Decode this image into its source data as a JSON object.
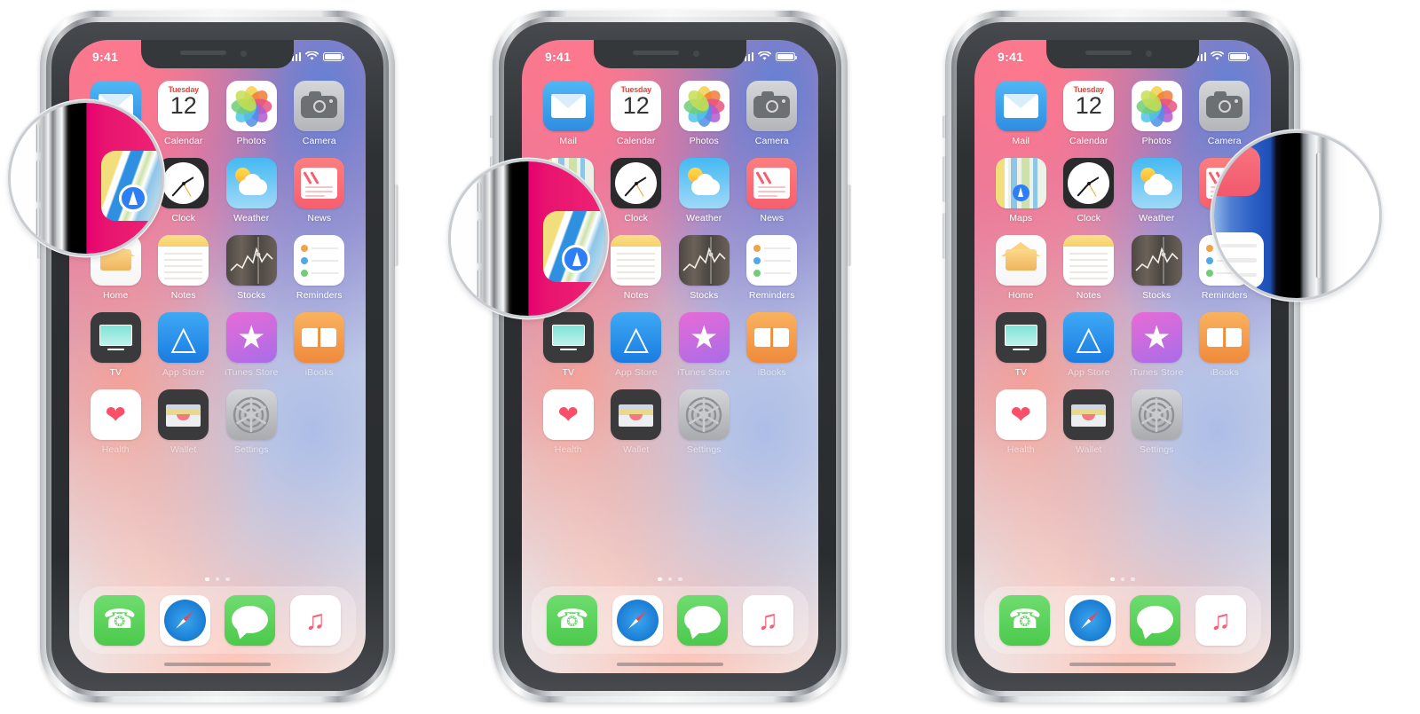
{
  "scene": {
    "title": "iPhone X hard reset / screenshot button sequence",
    "step_count": 3,
    "background_color": "#ffffff"
  },
  "phone": {
    "status_bar": {
      "time": "9:41",
      "signal_icon": "cellular-bars-icon",
      "wifi_icon": "wifi-icon",
      "battery_icon": "battery-full-icon"
    },
    "notch": {
      "speaker_icon": "earpiece-speaker-icon",
      "camera_icon": "front-camera-icon"
    },
    "home_screen": {
      "rows": [
        [
          {
            "label": "Mail",
            "icon": "mail-icon"
          },
          {
            "label": "Calendar",
            "icon": "calendar-icon",
            "weekday": "Tuesday",
            "day": "12"
          },
          {
            "label": "Photos",
            "icon": "photos-icon"
          },
          {
            "label": "Camera",
            "icon": "camera-icon"
          }
        ],
        [
          {
            "label": "Maps",
            "icon": "maps-icon"
          },
          {
            "label": "Clock",
            "icon": "clock-icon"
          },
          {
            "label": "Weather",
            "icon": "weather-icon"
          },
          {
            "label": "News",
            "icon": "news-icon"
          }
        ],
        [
          {
            "label": "Home",
            "icon": "home-icon"
          },
          {
            "label": "Notes",
            "icon": "notes-icon"
          },
          {
            "label": "Stocks",
            "icon": "stocks-icon"
          },
          {
            "label": "Reminders",
            "icon": "reminders-icon"
          }
        ],
        [
          {
            "label": "TV",
            "icon": "tv-icon"
          },
          {
            "label": "App Store",
            "icon": "app-store-icon"
          },
          {
            "label": "iTunes Store",
            "icon": "itunes-store-icon"
          },
          {
            "label": "iBooks",
            "icon": "ibooks-icon"
          }
        ],
        [
          {
            "label": "Health",
            "icon": "health-icon"
          },
          {
            "label": "Wallet",
            "icon": "wallet-icon"
          },
          {
            "label": "Settings",
            "icon": "settings-icon"
          },
          {
            "label": "",
            "icon": "empty-slot"
          }
        ]
      ],
      "page_dots": {
        "count": 3,
        "active_index": 0
      },
      "dock": [
        {
          "label": "Phone",
          "icon": "phone-icon"
        },
        {
          "label": "Safari",
          "icon": "safari-icon"
        },
        {
          "label": "Messages",
          "icon": "messages-icon"
        },
        {
          "label": "Music",
          "icon": "music-icon"
        }
      ],
      "home_indicator": "home-indicator-bar"
    },
    "hardware_buttons": {
      "volume_up": "volume-up-button",
      "volume_down": "volume-down-button",
      "ring_silent": "ring-silent-switch",
      "side_button": "side-button"
    }
  },
  "steps": [
    {
      "index": 1,
      "magnifier": "magnifier-volume-up",
      "highlight": "volume-up-button",
      "side": "left"
    },
    {
      "index": 2,
      "magnifier": "magnifier-volume-down",
      "highlight": "volume-down-button",
      "side": "left"
    },
    {
      "index": 3,
      "magnifier": "magnifier-side-button",
      "highlight": "side-button",
      "side": "right"
    }
  ],
  "colors": {
    "wallpaper_pink": "#ef7a90",
    "wallpaper_blue": "#5c82d7",
    "frame_silver": "#e6e8ea",
    "magnifier_ring": "#c9ccd0",
    "screen_magenta": "#e6006e",
    "screen_blue": "#1d4fb6"
  }
}
